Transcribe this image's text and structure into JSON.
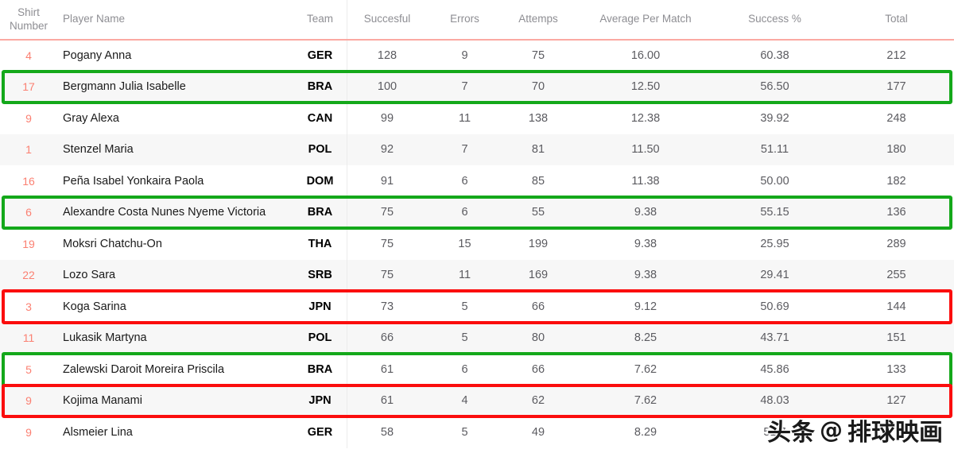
{
  "table": {
    "columns": [
      {
        "key": "shirt",
        "label": "Shirt\nNumber",
        "label_line1": "Shirt",
        "label_line2": "Number"
      },
      {
        "key": "player",
        "label": "Player Name"
      },
      {
        "key": "team",
        "label": "Team"
      },
      {
        "key": "succ",
        "label": "Succesful"
      },
      {
        "key": "err",
        "label": "Errors"
      },
      {
        "key": "att",
        "label": "Attemps"
      },
      {
        "key": "avg",
        "label": "Average Per Match"
      },
      {
        "key": "pct",
        "label": "Success %"
      },
      {
        "key": "total",
        "label": "Total"
      }
    ],
    "rows": [
      {
        "shirt": "4",
        "player": "Pogany Anna",
        "team": "GER",
        "succ": "128",
        "err": "9",
        "att": "75",
        "avg": "16.00",
        "pct": "60.38",
        "total": "212",
        "striped": false,
        "highlight": "none"
      },
      {
        "shirt": "17",
        "player": "Bergmann Julia Isabelle",
        "team": "BRA",
        "succ": "100",
        "err": "7",
        "att": "70",
        "avg": "12.50",
        "pct": "56.50",
        "total": "177",
        "striped": true,
        "highlight": "green"
      },
      {
        "shirt": "9",
        "player": "Gray Alexa",
        "team": "CAN",
        "succ": "99",
        "err": "11",
        "att": "138",
        "avg": "12.38",
        "pct": "39.92",
        "total": "248",
        "striped": false,
        "highlight": "none"
      },
      {
        "shirt": "1",
        "player": "Stenzel Maria",
        "team": "POL",
        "succ": "92",
        "err": "7",
        "att": "81",
        "avg": "11.50",
        "pct": "51.11",
        "total": "180",
        "striped": true,
        "highlight": "none"
      },
      {
        "shirt": "16",
        "player": "Peña Isabel Yonkaira Paola",
        "team": "DOM",
        "succ": "91",
        "err": "6",
        "att": "85",
        "avg": "11.38",
        "pct": "50.00",
        "total": "182",
        "striped": false,
        "highlight": "none"
      },
      {
        "shirt": "6",
        "player": "Alexandre Costa Nunes Nyeme Victoria",
        "team": "BRA",
        "succ": "75",
        "err": "6",
        "att": "55",
        "avg": "9.38",
        "pct": "55.15",
        "total": "136",
        "striped": true,
        "highlight": "green"
      },
      {
        "shirt": "19",
        "player": "Moksri Chatchu-On",
        "team": "THA",
        "succ": "75",
        "err": "15",
        "att": "199",
        "avg": "9.38",
        "pct": "25.95",
        "total": "289",
        "striped": false,
        "highlight": "none"
      },
      {
        "shirt": "22",
        "player": "Lozo Sara",
        "team": "SRB",
        "succ": "75",
        "err": "11",
        "att": "169",
        "avg": "9.38",
        "pct": "29.41",
        "total": "255",
        "striped": true,
        "highlight": "none"
      },
      {
        "shirt": "3",
        "player": "Koga Sarina",
        "team": "JPN",
        "succ": "73",
        "err": "5",
        "att": "66",
        "avg": "9.12",
        "pct": "50.69",
        "total": "144",
        "striped": false,
        "highlight": "red"
      },
      {
        "shirt": "11",
        "player": "Lukasik Martyna",
        "team": "POL",
        "succ": "66",
        "err": "5",
        "att": "80",
        "avg": "8.25",
        "pct": "43.71",
        "total": "151",
        "striped": true,
        "highlight": "none"
      },
      {
        "shirt": "5",
        "player": "Zalewski Daroit Moreira Priscila",
        "team": "BRA",
        "succ": "61",
        "err": "6",
        "att": "66",
        "avg": "7.62",
        "pct": "45.86",
        "total": "133",
        "striped": false,
        "highlight": "green"
      },
      {
        "shirt": "9",
        "player": "Kojima Manami",
        "team": "JPN",
        "succ": "61",
        "err": "4",
        "att": "62",
        "avg": "7.62",
        "pct": "48.03",
        "total": "127",
        "striped": true,
        "highlight": "red"
      },
      {
        "shirt": "9",
        "player": "Alsmeier Lina",
        "team": "GER",
        "succ": "58",
        "err": "5",
        "att": "49",
        "avg": "8.29",
        "pct": "51.7",
        "total": "",
        "striped": false,
        "highlight": "none"
      }
    ]
  },
  "colors": {
    "highlight_green": "#14a81a",
    "highlight_red": "#fb0d0d",
    "shirt_number": "#fb8072",
    "header_rule": "#fba9a2",
    "stripe": "#f7f7f7"
  },
  "watermark": {
    "logo": "头条",
    "at": "@",
    "handle": "排球映画"
  }
}
